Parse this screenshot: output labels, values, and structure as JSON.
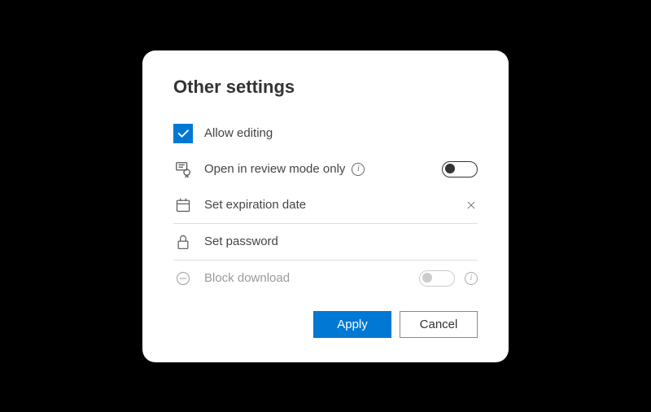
{
  "title": "Other settings",
  "rows": {
    "allow_editing": {
      "label": "Allow editing"
    },
    "review_mode": {
      "label": "Open in review mode only"
    },
    "expiration": {
      "label": "Set expiration date"
    },
    "password": {
      "label": "Set password"
    },
    "block_download": {
      "label": "Block download"
    }
  },
  "buttons": {
    "apply": "Apply",
    "cancel": "Cancel"
  }
}
